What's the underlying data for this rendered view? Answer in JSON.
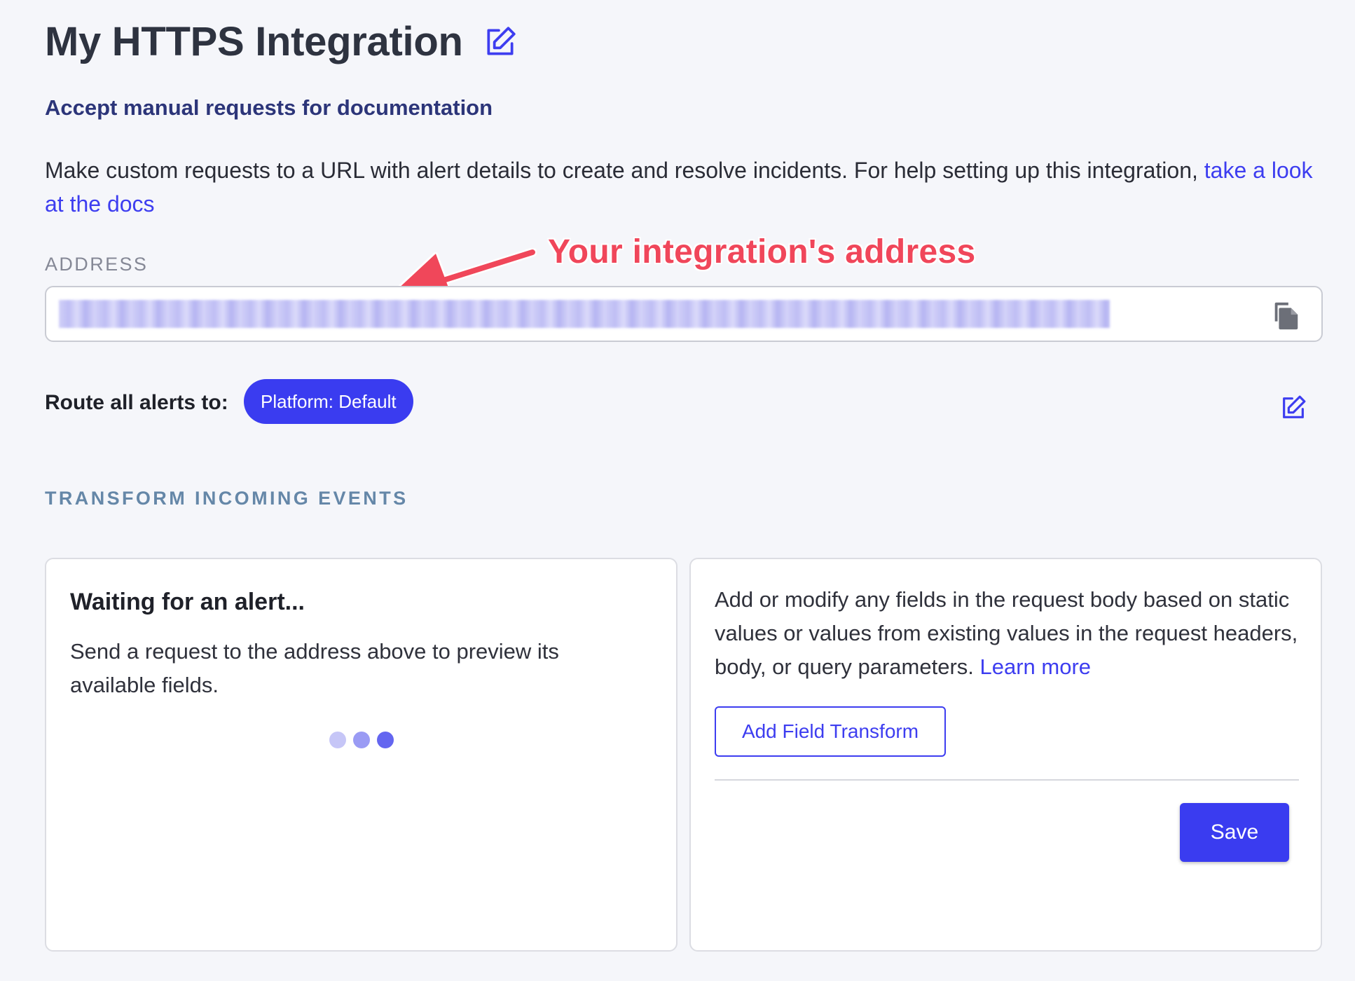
{
  "header": {
    "title": "My HTTPS Integration",
    "subtitle": "Accept manual requests for documentation"
  },
  "description": {
    "text": "Make custom requests to a URL with alert details to create and resolve incidents. For help setting up this integration, ",
    "link": "take a look at the docs"
  },
  "address": {
    "label": "ADDRESS",
    "value": ""
  },
  "annotation": {
    "text": "Your integration's address",
    "color": "#f0465a"
  },
  "routing": {
    "label": "Route all alerts to:",
    "target": "Platform: Default"
  },
  "transform": {
    "section_label": "TRANSFORM INCOMING EVENTS",
    "preview": {
      "title": "Waiting for an alert...",
      "text": "Send a request to the address above to preview its available fields.",
      "loader_colors": [
        "#c6c6f7",
        "#9a9bf4",
        "#6466f0"
      ]
    },
    "fields": {
      "text": "Add or modify any fields in the request body based on static values or values from existing values in the request headers, body, or query parameters. ",
      "link": "Learn more",
      "add_button": "Add Field Transform",
      "save_button": "Save"
    }
  },
  "colors": {
    "accent": "#3a3cf0",
    "link": "#3d3df0",
    "subtitle": "#2c3579",
    "section": "#6587a8",
    "background": "#f5f6fa"
  },
  "icons": {
    "title_edit": "edit-icon",
    "copy": "copy-icon",
    "route_edit": "edit-icon"
  }
}
